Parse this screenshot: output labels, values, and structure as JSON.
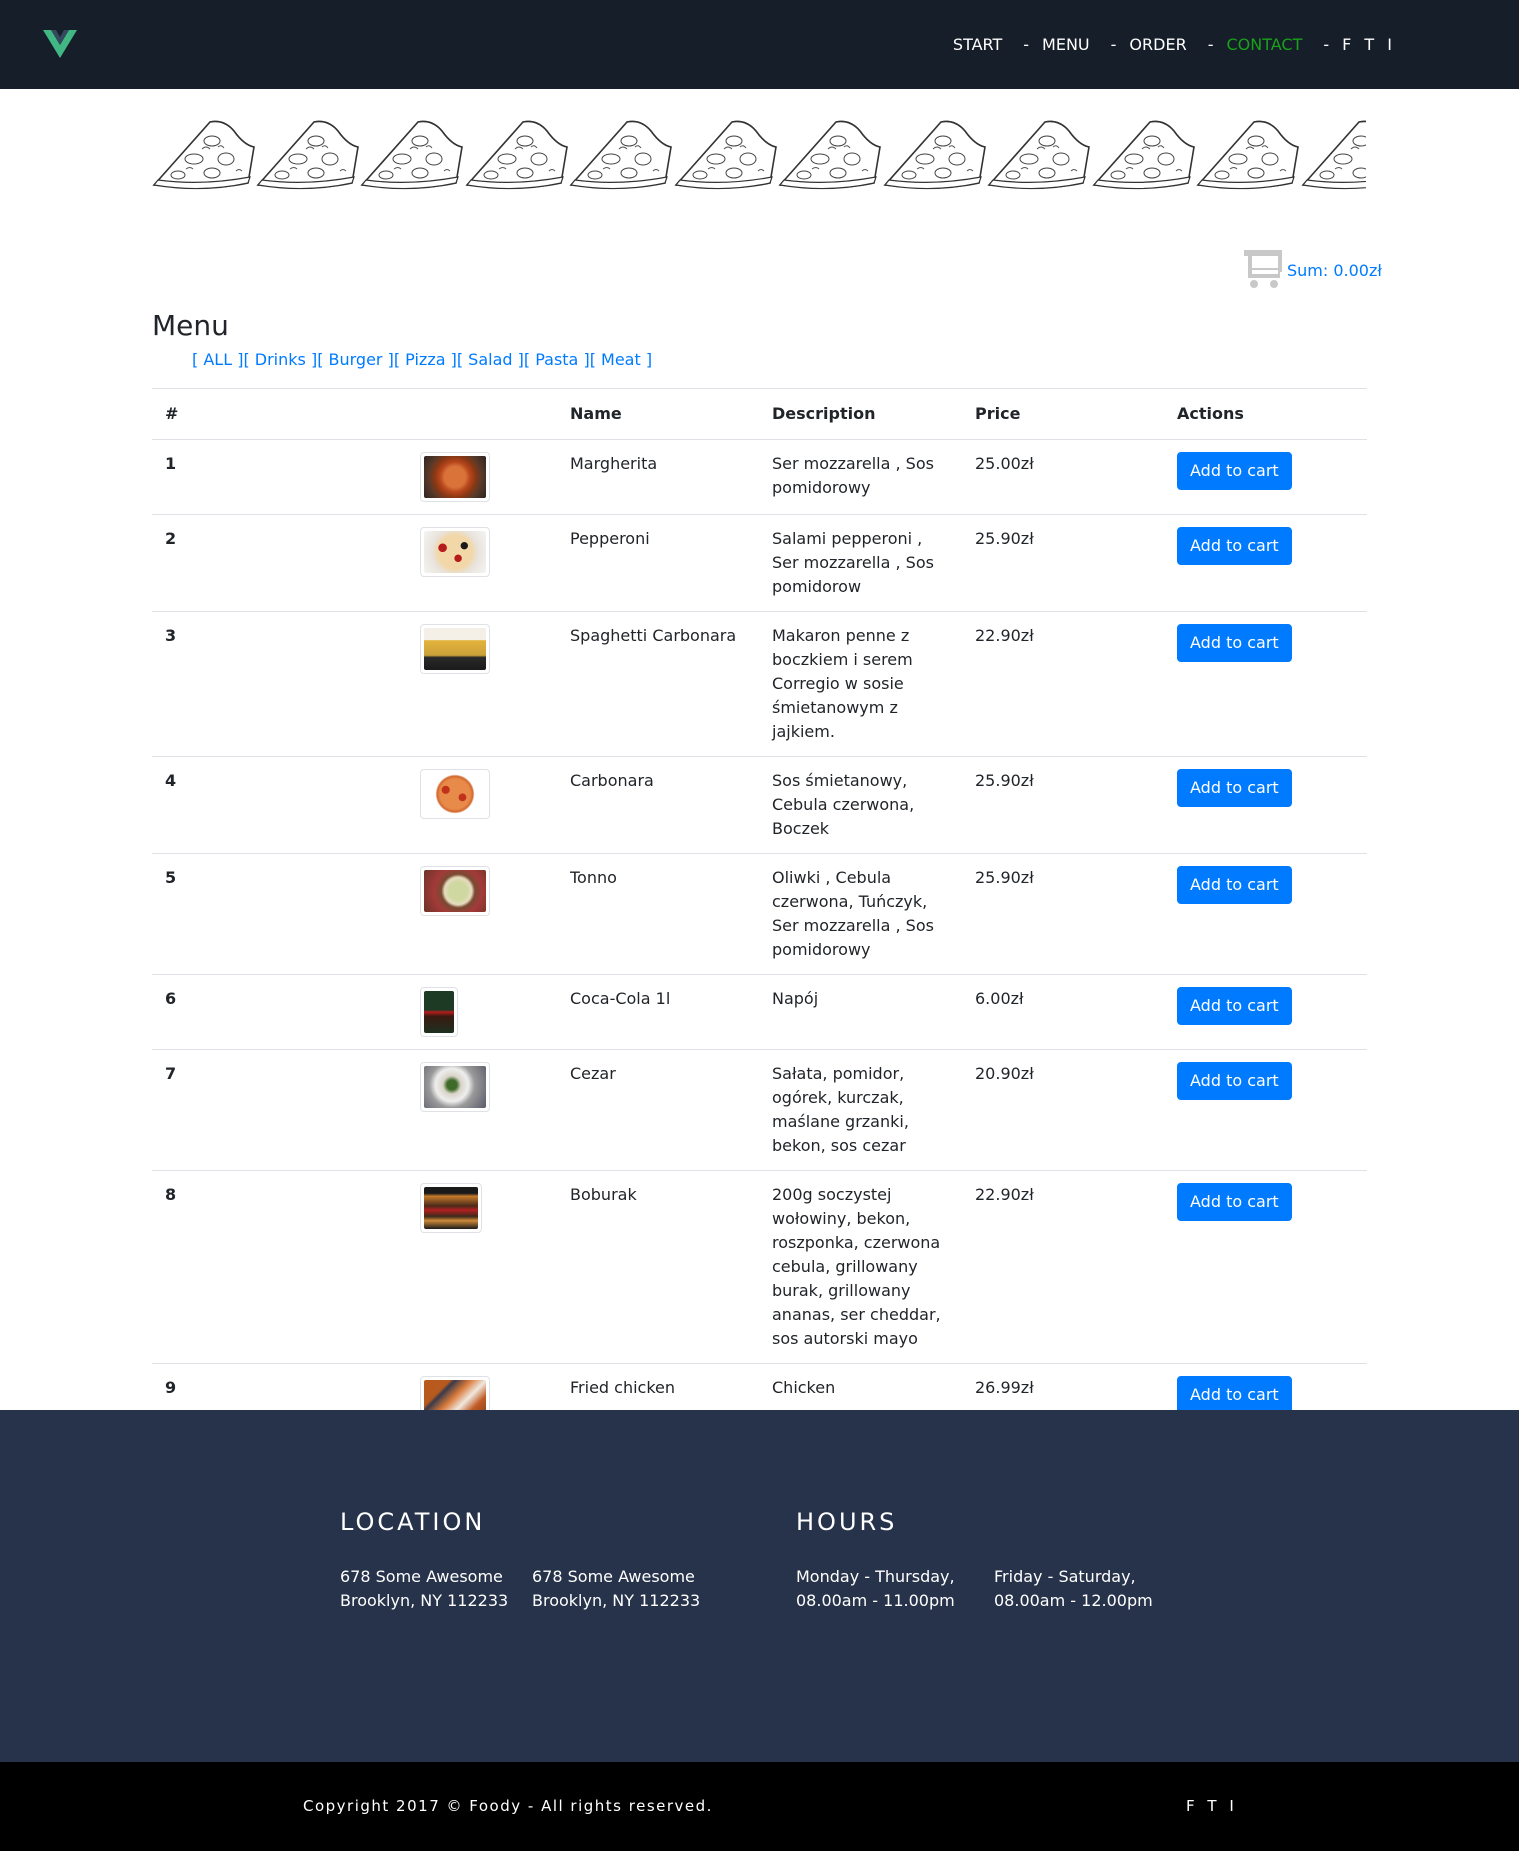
{
  "nav": {
    "items": [
      {
        "label": "START"
      },
      {
        "label": "MENU"
      },
      {
        "label": "ORDER"
      },
      {
        "label": "CONTACT"
      },
      {
        "label": "F T I"
      }
    ],
    "separator": "-",
    "active_color": "#1aa01a"
  },
  "cart": {
    "sum": "Sum: 0.00zł",
    "icon": "cart-icon"
  },
  "menu": {
    "title": "Menu",
    "filters": [
      "[ ALL ]",
      "[ Drinks ]",
      "[ Burger ]",
      "[ Pizza ]",
      "[ Salad ]",
      "[ Pasta ]",
      "[ Meat ]"
    ],
    "columns": [
      "#",
      "",
      "Name",
      "Description",
      "Price",
      "Actions"
    ],
    "add_label": "Add to cart",
    "rows": [
      {
        "num": "1",
        "name": "Margherita",
        "desc": "Ser mozzarella , Sos pomidorowy",
        "price": "25.00zł"
      },
      {
        "num": "2",
        "name": "Pepperoni",
        "desc": "Salami pepperoni , Ser mozzarella , Sos pomidorow",
        "price": "25.90zł"
      },
      {
        "num": "3",
        "name": "Spaghetti Carbonara",
        "desc": "Makaron penne z boczkiem i serem Corregio w sosie śmietanowym z jajkiem.",
        "price": "22.90zł"
      },
      {
        "num": "4",
        "name": "Carbonara",
        "desc": "Sos śmietanowy, Cebula czerwona, Boczek",
        "price": "25.90zł"
      },
      {
        "num": "5",
        "name": "Tonno",
        "desc": "Oliwki , Cebula czerwona, Tuńczyk, Ser mozzarella , Sos pomidorowy",
        "price": "25.90zł"
      },
      {
        "num": "6",
        "name": "Coca-Cola 1l",
        "desc": "Napój",
        "price": "6.00zł"
      },
      {
        "num": "7",
        "name": "Cezar",
        "desc": "Sałata, pomidor, ogórek, kurczak, maślane grzanki, bekon, sos cezar",
        "price": "20.90zł"
      },
      {
        "num": "8",
        "name": "Boburak",
        "desc": "200g soczystej wołowiny, bekon, roszponka, czerwona cebula, grillowany burak, grillowany ananas, ser cheddar, sos autorski mayo",
        "price": "22.90zł"
      },
      {
        "num": "9",
        "name": "Fried chicken",
        "desc": "Chicken",
        "price": "26.99zł"
      }
    ]
  },
  "footer": {
    "location_title": "LOCATION",
    "hours_title": "HOURS",
    "loc1_line1": "678 Some Awesome",
    "loc1_line2": "Brooklyn, NY 112233",
    "loc2_line1": "678 Some Awesome",
    "loc2_line2": "Brooklyn, NY 112233",
    "hours1_line1": "Monday - Thursday,",
    "hours1_line2": "08.00am - 11.00pm",
    "hours2_line1": "Friday - Saturday,",
    "hours2_line2": "08.00am - 12.00pm",
    "copyright": "Copyright 2017 © Foody - All rights reserved.",
    "brand": "F T I"
  }
}
